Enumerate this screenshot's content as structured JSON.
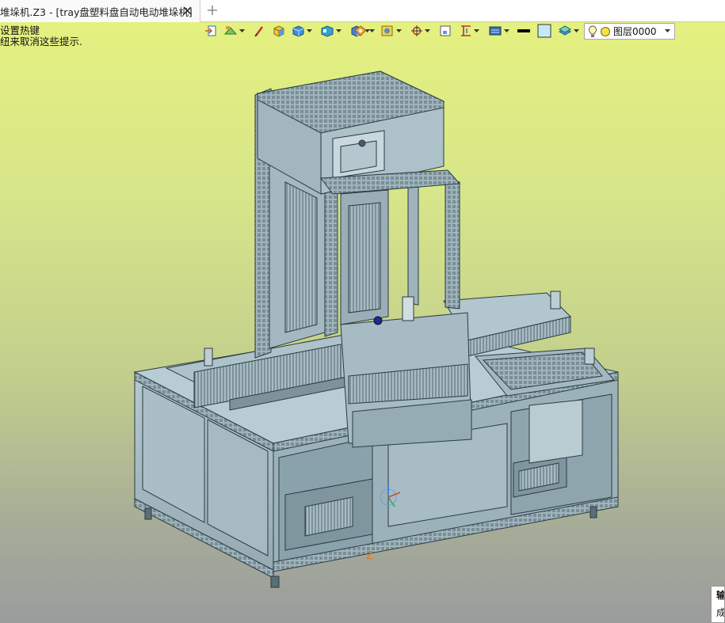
{
  "tab": {
    "label": "堆垛机.Z3 - [tray盘塑料盘自动电动堆垛机]"
  },
  "hint": {
    "line1": "设置热键",
    "line2": "纽来取消这些提示."
  },
  "toolbar": {
    "icons": [
      "open-file-icon",
      "render-mode-icon",
      "pen-icon",
      "box-solid-icon",
      "cube-icon",
      "view-cube-icon",
      "shade-icon",
      "orbit-icon",
      "wire-icon",
      "snap-icon",
      "frame-icon",
      "dimension-icon",
      "filter-icon",
      "line-color-icon",
      "fill-color-icon",
      "layers-icon",
      "bulb-icon"
    ],
    "line_color": "#000000",
    "fill_color": "#c8e8f5"
  },
  "layer": {
    "name": "图层0000",
    "status_color": "#f4e04a"
  },
  "viewport": {
    "axis_label": "Z",
    "model_color": "#a9c0c8"
  },
  "output": {
    "title": "输",
    "line": "成"
  }
}
